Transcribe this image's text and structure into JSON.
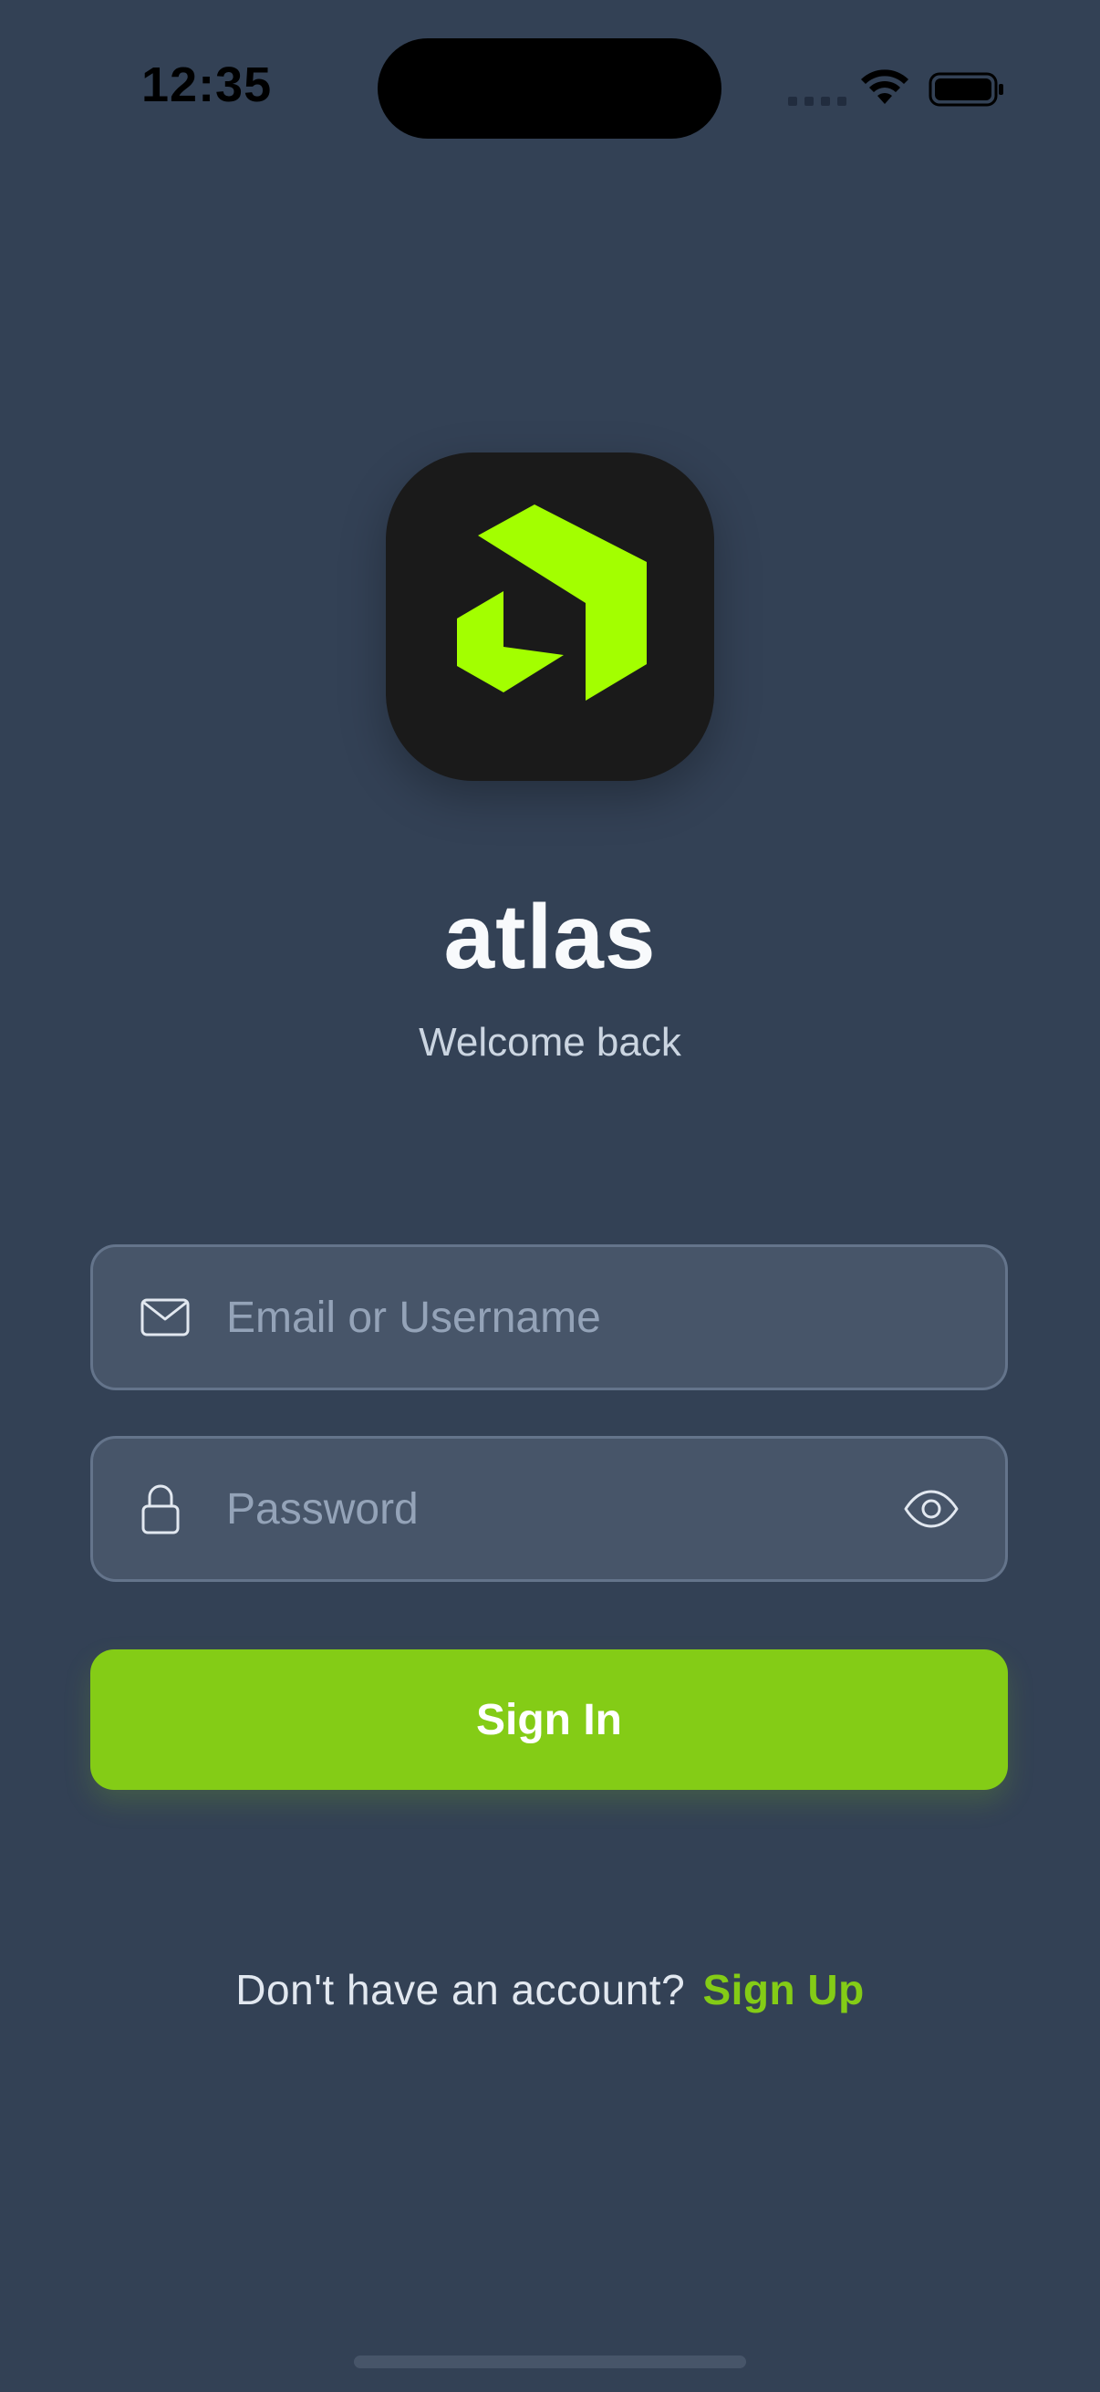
{
  "status_bar": {
    "time": "12:35",
    "signal_icon": "signal-dots-icon",
    "wifi_icon": "wifi-icon",
    "battery_icon": "battery-icon"
  },
  "app": {
    "logo_icon": "atlas-logo-icon",
    "name": "atlas",
    "subtitle": "Welcome back"
  },
  "form": {
    "email": {
      "icon": "mail-icon",
      "placeholder": "Email or Username",
      "value": ""
    },
    "password": {
      "icon": "lock-icon",
      "placeholder": "Password",
      "value": "",
      "toggle_icon": "eye-icon"
    },
    "submit_label": "Sign In"
  },
  "footer": {
    "prompt": "Don't have an account?",
    "link_label": "Sign Up"
  },
  "colors": {
    "background": "#334155",
    "accent": "#84cc16",
    "logo_green": "#a3ff00",
    "field_bg": "#475569",
    "text_primary": "#f8fafc",
    "text_muted": "#94a3b8"
  }
}
